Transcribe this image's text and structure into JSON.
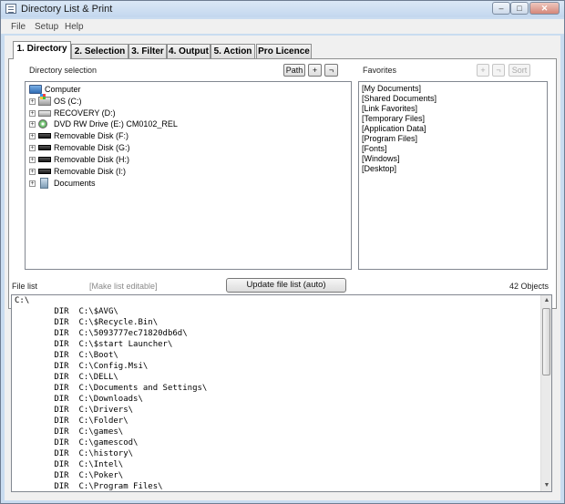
{
  "window": {
    "title": "Directory List & Print"
  },
  "menu": [
    "File",
    "Setup",
    "Help"
  ],
  "tabs": [
    "1. Directory",
    "2. Selection",
    "3. Filter",
    "4. Output",
    "5. Action",
    "Pro Licence"
  ],
  "directory": {
    "label": "Directory selection",
    "buttons": {
      "path": "Path",
      "add": "+",
      "remove": "¬"
    },
    "tree": [
      {
        "label": "Computer",
        "icon": "computer-icon"
      },
      {
        "label": "OS (C:)",
        "icon": "os-drive-icon"
      },
      {
        "label": "RECOVERY (D:)",
        "icon": "hard-drive-icon"
      },
      {
        "label": "DVD RW Drive (E:) CM0102_REL",
        "icon": "dvd-drive-icon"
      },
      {
        "label": "Removable Disk (F:)",
        "icon": "removable-disk-icon"
      },
      {
        "label": "Removable Disk (G:)",
        "icon": "removable-disk-icon"
      },
      {
        "label": "Removable Disk (H:)",
        "icon": "removable-disk-icon"
      },
      {
        "label": "Removable Disk (I:)",
        "icon": "removable-disk-icon"
      },
      {
        "label": "Documents",
        "icon": "documents-icon"
      }
    ]
  },
  "favorites": {
    "label": "Favorites",
    "buttons": {
      "add": "+",
      "remove": "¬",
      "sort": "Sort"
    },
    "items": [
      "[My Documents]",
      "[Shared Documents]",
      "[Link Favorites]",
      "[Temporary Files]",
      "[Application Data]",
      "[Program Files]",
      "[Fonts]",
      "[Windows]",
      "[Desktop]"
    ]
  },
  "filelist": {
    "label": "File list",
    "editable_link": "[Make list editable]",
    "update_button": "Update file list (auto)",
    "count": "42 Objects",
    "root": "C:\\",
    "entries": [
      "        DIR  C:\\$AVG\\",
      "        DIR  C:\\$Recycle.Bin\\",
      "        DIR  C:\\5093777ec71820db6d\\",
      "        DIR  C:\\$start Launcher\\",
      "        DIR  C:\\Boot\\",
      "        DIR  C:\\Config.Msi\\",
      "        DIR  C:\\DELL\\",
      "        DIR  C:\\Documents and Settings\\",
      "        DIR  C:\\Downloads\\",
      "        DIR  C:\\Drivers\\",
      "        DIR  C:\\Folder\\",
      "        DIR  C:\\games\\",
      "        DIR  C:\\gamescod\\",
      "        DIR  C:\\history\\",
      "        DIR  C:\\Intel\\",
      "        DIR  C:\\Poker\\",
      "        DIR  C:\\Program Files\\"
    ]
  }
}
